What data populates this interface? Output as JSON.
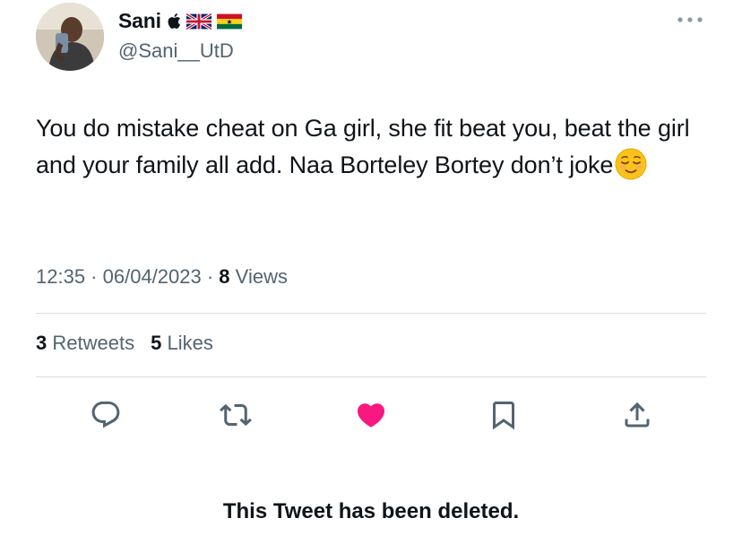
{
  "author": {
    "name": "Sani",
    "handle": "@Sani__UtD",
    "name_badges": [
      "apple-icon",
      "uk-flag-icon",
      "ghana-flag-icon"
    ]
  },
  "tweet": {
    "text": "You do mistake cheat on Ga girl, she fit beat you, beat the girl and your family all add. Naa Borteley Bortey don’t joke",
    "trailing_emoji": "relieved-face-emoji",
    "time": "12:35",
    "date": "06/04/2023",
    "separator": " · ",
    "views_count": "8",
    "views_label": "Views"
  },
  "stats": {
    "retweets_count": "3",
    "retweets_label": "Retweets",
    "likes_count": "5",
    "likes_label": "Likes"
  },
  "actions": [
    {
      "icon": "reply-icon"
    },
    {
      "icon": "retweet-icon"
    },
    {
      "icon": "like-heart-icon",
      "active": true,
      "color": "#f91880"
    },
    {
      "icon": "bookmark-icon"
    },
    {
      "icon": "share-icon"
    }
  ],
  "notice": {
    "text": "This Tweet has been deleted."
  },
  "colors": {
    "text_primary": "#0f1419",
    "text_secondary": "#536471",
    "like_active": "#f91880",
    "icon": "#536471",
    "divider": "#dadfe3"
  }
}
